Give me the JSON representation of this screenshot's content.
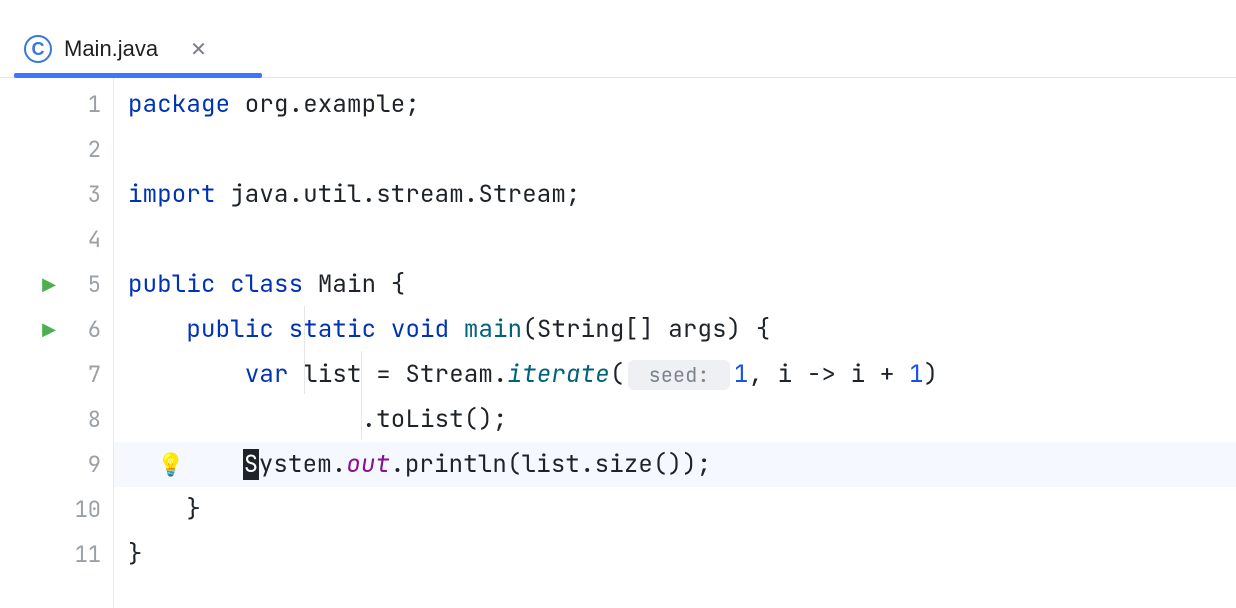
{
  "tab": {
    "icon_letter": "C",
    "filename": "Main.java"
  },
  "gutter": {
    "lines": [
      "1",
      "2",
      "3",
      "4",
      "5",
      "6",
      "7",
      "8",
      "9",
      "10",
      "11"
    ],
    "run_markers": [
      5,
      6
    ],
    "bulb_line": 9
  },
  "code": {
    "l1": {
      "kw": "package",
      "rest": " org.example;"
    },
    "l3": {
      "kw": "import",
      "rest": " java.util.stream.Stream;"
    },
    "l5": {
      "kw1": "public",
      "kw2": "class",
      "cls": "Main",
      "brace": " {"
    },
    "l6": {
      "kw1": "public",
      "kw2": "static",
      "kw3": "void",
      "name": "main",
      "params": "(String[] args) {"
    },
    "l7": {
      "kw": "var",
      "ident": " list = Stream.",
      "sm": "iterate",
      "open": "(",
      "hint": " seed: ",
      "num1": "1",
      "mid": ", i -> i + ",
      "num2": "1",
      "close": ")"
    },
    "l8": {
      "text": ".toList();"
    },
    "l9": {
      "caret": "S",
      "a": "ystem.",
      "field": "out",
      "b": ".println(list.size());"
    },
    "l10": {
      "text": "}"
    },
    "l11": {
      "text": "}"
    }
  }
}
